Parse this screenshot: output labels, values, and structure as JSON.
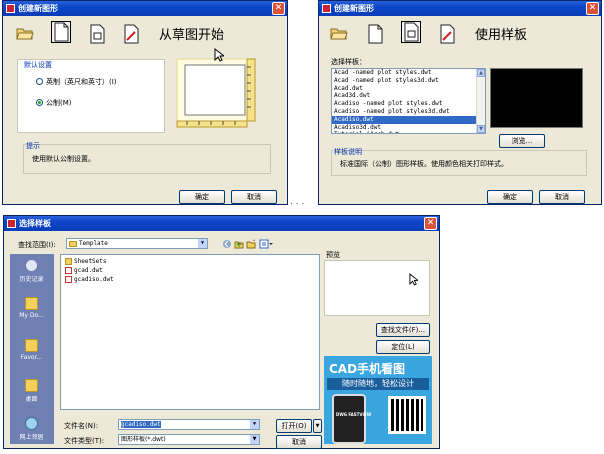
{
  "dialog1": {
    "title": "创建新图形",
    "heading": "从草图开始",
    "group_label": "默认设置",
    "radio_imperial": "英制（英尺和英寸）(I)",
    "radio_metric": "公制(M)",
    "tip_label": "提示",
    "tip_text": "使用默认公制设置。",
    "ok": "确定",
    "cancel": "取消"
  },
  "dialog2": {
    "title": "创建新图形",
    "heading": "使用样板",
    "list_label": "选择样板：",
    "templates": [
      "Acad -named plot styles.dwt",
      "Acad -named plot styles3d.dwt",
      "Acad.dwt",
      "Acad3d.dwt",
      "Acadiso -named plot styles.dwt",
      "Acadiso -named plot styles3d.dwt",
      "Acadiso.dwt",
      "Acadiso3d.dwt",
      "Tutorial iArch.dwt"
    ],
    "selected_index": 6,
    "browse": "浏览...",
    "desc_label": "样板说明",
    "desc_text": "标准国际（公制）图形样板。使用颜色相关打印样式。",
    "ok": "确定",
    "cancel": "取消"
  },
  "separator": ". . .",
  "dialog3": {
    "title": "选择样板",
    "lookin_label": "查找范围(I):",
    "lookin_value": "Template",
    "places": [
      "历史记录",
      "My Do...",
      "Favor...",
      "桌面",
      "网上邻居"
    ],
    "files": [
      {
        "name": "SheetSets",
        "type": "folder"
      },
      {
        "name": "gcad.dwt",
        "type": "dwt"
      },
      {
        "name": "gcadiso.dwt",
        "type": "dwt"
      }
    ],
    "preview_label": "预览",
    "find_file": "查找文件(F)...",
    "locate": "定位(L)",
    "filename_label": "文件名(N):",
    "filename_value": "gcadiso.dwt",
    "filetype_label": "文件类型(T):",
    "filetype_value": "图形样板(*.dwt)",
    "open": "打开(O)",
    "cancel": "取消"
  },
  "ad": {
    "line1": "CAD手机看图",
    "line2": "随时随地，轻松设计",
    "badge": "DWG FASTVIEW"
  }
}
